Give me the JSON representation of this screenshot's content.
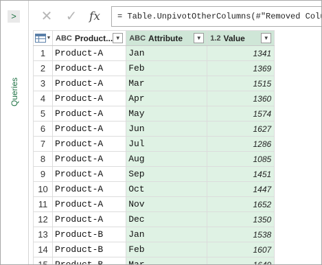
{
  "side_pane": {
    "label": "Queries",
    "expand_glyph": ">"
  },
  "formula_bar": {
    "cancel_glyph": "✕",
    "commit_glyph": "✓",
    "fx_label": "fx",
    "formula": "= Table.UnpivotOtherColumns(#\"Removed Columns\", {\"Product\"}, \"Attribute\", \"Value\")"
  },
  "columns": [
    {
      "type_icon": "ABC",
      "name": "Product...",
      "selected": false
    },
    {
      "type_icon": "ABC",
      "name": "Attribute",
      "selected": true
    },
    {
      "type_icon": "1.2",
      "name": "Value",
      "selected": true
    }
  ],
  "rows": [
    {
      "n": "1",
      "product": "Product-A",
      "attribute": "Jan",
      "value": "1341"
    },
    {
      "n": "2",
      "product": "Product-A",
      "attribute": "Feb",
      "value": "1369"
    },
    {
      "n": "3",
      "product": "Product-A",
      "attribute": "Mar",
      "value": "1515"
    },
    {
      "n": "4",
      "product": "Product-A",
      "attribute": "Apr",
      "value": "1360"
    },
    {
      "n": "5",
      "product": "Product-A",
      "attribute": "May",
      "value": "1574"
    },
    {
      "n": "6",
      "product": "Product-A",
      "attribute": "Jun",
      "value": "1627"
    },
    {
      "n": "7",
      "product": "Product-A",
      "attribute": "Jul",
      "value": "1286"
    },
    {
      "n": "8",
      "product": "Product-A",
      "attribute": "Aug",
      "value": "1085"
    },
    {
      "n": "9",
      "product": "Product-A",
      "attribute": "Sep",
      "value": "1451"
    },
    {
      "n": "10",
      "product": "Product-A",
      "attribute": "Oct",
      "value": "1447"
    },
    {
      "n": "11",
      "product": "Product-A",
      "attribute": "Nov",
      "value": "1652"
    },
    {
      "n": "12",
      "product": "Product-A",
      "attribute": "Dec",
      "value": "1350"
    },
    {
      "n": "13",
      "product": "Product-B",
      "attribute": "Jan",
      "value": "1538"
    },
    {
      "n": "14",
      "product": "Product-B",
      "attribute": "Feb",
      "value": "1607"
    },
    {
      "n": "15",
      "product": "Product-B",
      "attribute": "Mar",
      "value": "1649"
    }
  ],
  "colors": {
    "accent_green": "#217346",
    "selected_header": "#cfe6d7",
    "selected_cells": "#dff2e4"
  }
}
